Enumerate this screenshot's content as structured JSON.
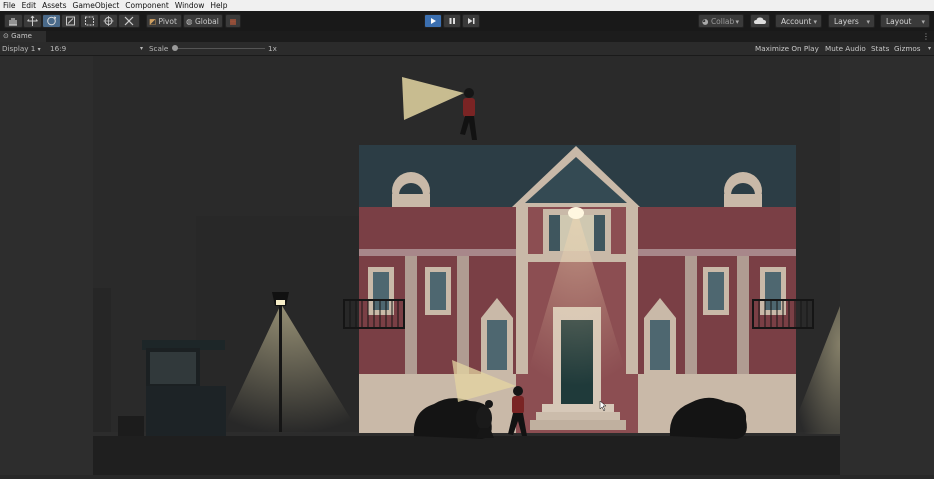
{
  "menu": [
    "File",
    "Edit",
    "Assets",
    "GameObject",
    "Component",
    "Window",
    "Help"
  ],
  "toolbar": {
    "tools": [
      {
        "icon": "hand-tool-icon"
      },
      {
        "icon": "move-tool-icon"
      },
      {
        "icon": "rotate-tool-icon"
      },
      {
        "icon": "scale-tool-icon"
      },
      {
        "icon": "rect-tool-icon"
      },
      {
        "icon": "transform-tool-icon"
      },
      {
        "icon": "custom-tool-icon"
      }
    ],
    "pivot_label": "Pivot",
    "global_label": "Global",
    "collab_label": "Collab",
    "account_label": "Account",
    "layers_label": "Layers",
    "layout_label": "Layout"
  },
  "tab": {
    "label": "Game"
  },
  "game_toolbar": {
    "display_label": "Display 1",
    "aspect_label": "16:9",
    "scale_label": "Scale",
    "scale_value": "1x",
    "scale_level": 0.0,
    "maximize_label": "Maximize On Play",
    "mute_label": "Mute Audio",
    "stats_label": "Stats",
    "gizmos_label": "Gizmos"
  },
  "colors": {
    "play_accent": "#3b6fb0",
    "sky": "#2b2b2b",
    "wall": "#7a3f45",
    "roof": "#2c3d45",
    "trim": "#c9b9a8",
    "lamp_light": "#f2e6b4"
  }
}
